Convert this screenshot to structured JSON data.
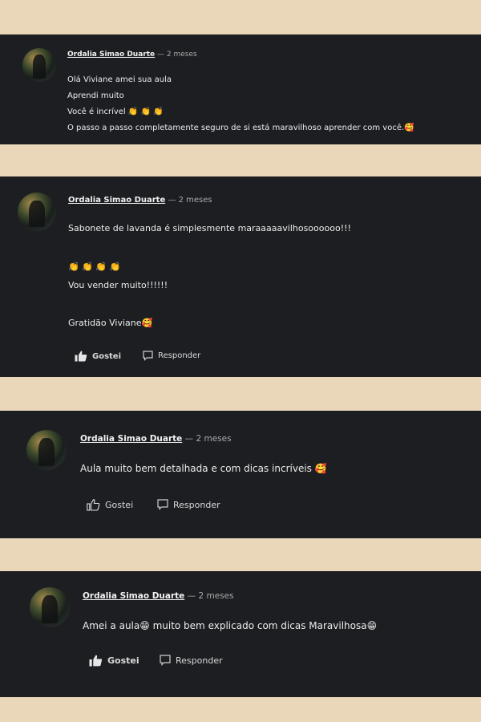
{
  "comments": [
    {
      "author": "Ordalia Simao Duarte",
      "separator": "—",
      "time": "2 meses",
      "lines": [
        "Olá Viviane amei sua aula",
        "Aprendi muito",
        "Você é incrível 👏 👏 👏",
        "O passo a passo  completamente seguro de si está  maravilhoso aprender com você.🥰"
      ]
    },
    {
      "author": "Ordalia Simao Duarte",
      "separator": "—",
      "time": "2 meses",
      "lines": [
        "Sabonete de lavanda é simplesmente maraaaaavilhosoooooo!!!",
        "👏 👏 👏 👏",
        "Vou vender muito!!!!!!",
        "Gratidão Viviane🥰"
      ],
      "like_label": "Gostei",
      "reply_label": "Responder",
      "liked": true
    },
    {
      "author": "Ordalia Simao Duarte",
      "separator": "—",
      "time": "2 meses",
      "lines": [
        "Aula muito bem detalhada e com dicas incríveis 🥰"
      ],
      "like_label": "Gostei",
      "reply_label": "Responder",
      "liked": false
    },
    {
      "author": "Ordalia Simao Duarte",
      "separator": "—",
      "time": "2 meses",
      "lines": [
        "Amei a aula😁 muito bem explicado com dicas Maravilhosa😁"
      ],
      "like_label": "Gostei",
      "reply_label": "Responder",
      "liked": true
    }
  ]
}
